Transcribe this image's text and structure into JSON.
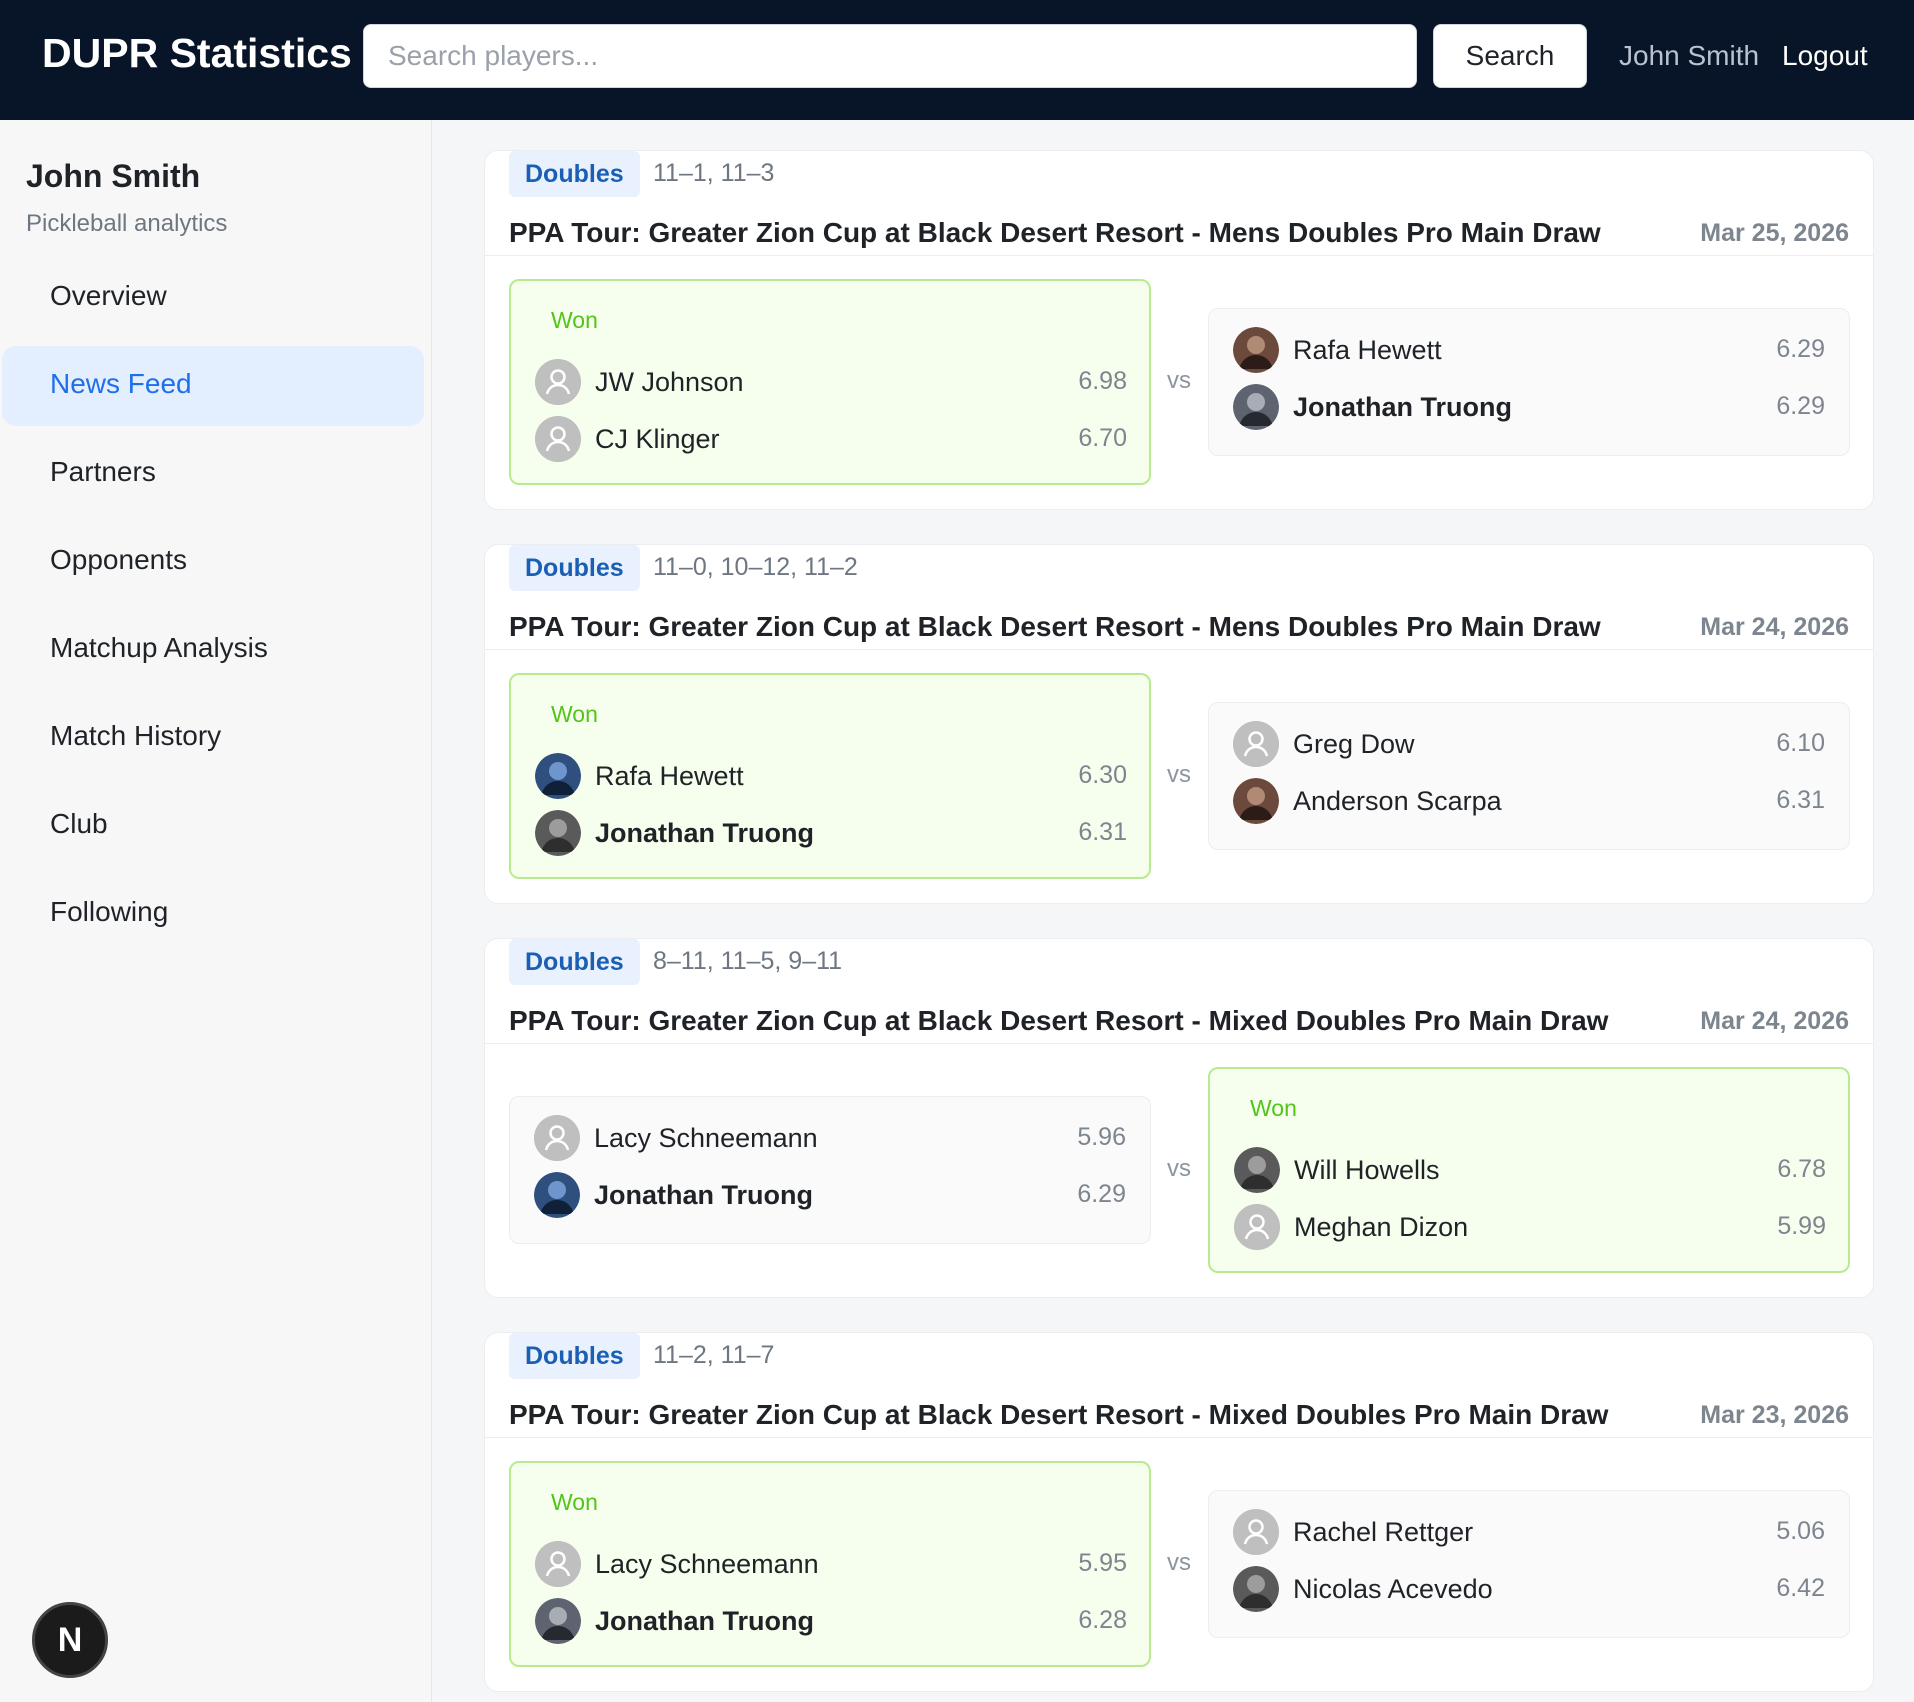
{
  "header": {
    "brand": "DUPR Statistics",
    "search_placeholder": "Search players...",
    "search_button": "Search",
    "user_name": "John Smith",
    "logout": "Logout"
  },
  "sidebar": {
    "user_name": "John Smith",
    "subtitle": "Pickleball analytics",
    "items": [
      {
        "label": "Overview",
        "active": false
      },
      {
        "label": "News Feed",
        "active": true
      },
      {
        "label": "Partners",
        "active": false
      },
      {
        "label": "Opponents",
        "active": false
      },
      {
        "label": "Matchup Analysis",
        "active": false
      },
      {
        "label": "Match History",
        "active": false
      },
      {
        "label": "Club",
        "active": false
      },
      {
        "label": "Following",
        "active": false
      }
    ],
    "badge_letter": "N"
  },
  "vs_label": "vs",
  "won_label": "Won",
  "matches": [
    {
      "type": "Doubles",
      "scores": "11–1, 11–3",
      "title": "PPA Tour: Greater Zion Cup at Black Desert Resort - Mens Doubles Pro Main Draw",
      "date": "Mar 25, 2026",
      "winner": "left",
      "left": [
        {
          "name": "JW Johnson",
          "rating": "6.98",
          "bold": false,
          "avatar": "default"
        },
        {
          "name": "CJ Klinger",
          "rating": "6.70",
          "bold": false,
          "avatar": "default"
        }
      ],
      "right": [
        {
          "name": "Rafa Hewett",
          "rating": "6.29",
          "bold": false,
          "avatar": "photo"
        },
        {
          "name": "Jonathan Truong",
          "rating": "6.29",
          "bold": true,
          "avatar": "photo"
        }
      ]
    },
    {
      "type": "Doubles",
      "scores": "11–0, 10–12, 11–2",
      "title": "PPA Tour: Greater Zion Cup at Black Desert Resort - Mens Doubles Pro Main Draw",
      "date": "Mar 24, 2026",
      "winner": "left",
      "left": [
        {
          "name": "Rafa Hewett",
          "rating": "6.30",
          "bold": false,
          "avatar": "photo"
        },
        {
          "name": "Jonathan Truong",
          "rating": "6.31",
          "bold": true,
          "avatar": "photo"
        }
      ],
      "right": [
        {
          "name": "Greg Dow",
          "rating": "6.10",
          "bold": false,
          "avatar": "default"
        },
        {
          "name": "Anderson Scarpa",
          "rating": "6.31",
          "bold": false,
          "avatar": "photo"
        }
      ]
    },
    {
      "type": "Doubles",
      "scores": "8–11, 11–5, 9–11",
      "title": "PPA Tour: Greater Zion Cup at Black Desert Resort - Mixed Doubles Pro Main Draw",
      "date": "Mar 24, 2026",
      "winner": "right",
      "left": [
        {
          "name": "Lacy Schneemann",
          "rating": "5.96",
          "bold": false,
          "avatar": "default"
        },
        {
          "name": "Jonathan Truong",
          "rating": "6.29",
          "bold": true,
          "avatar": "photo"
        }
      ],
      "right": [
        {
          "name": "Will Howells",
          "rating": "6.78",
          "bold": false,
          "avatar": "photo"
        },
        {
          "name": "Meghan Dizon",
          "rating": "5.99",
          "bold": false,
          "avatar": "default"
        }
      ]
    },
    {
      "type": "Doubles",
      "scores": "11–2, 11–7",
      "title": "PPA Tour: Greater Zion Cup at Black Desert Resort - Mixed Doubles Pro Main Draw",
      "date": "Mar 23, 2026",
      "winner": "left",
      "left": [
        {
          "name": "Lacy Schneemann",
          "rating": "5.95",
          "bold": false,
          "avatar": "default"
        },
        {
          "name": "Jonathan Truong",
          "rating": "6.28",
          "bold": true,
          "avatar": "photo"
        }
      ],
      "right": [
        {
          "name": "Rachel Rettger",
          "rating": "5.06",
          "bold": false,
          "avatar": "default"
        },
        {
          "name": "Nicolas Acevedo",
          "rating": "6.42",
          "bold": false,
          "avatar": "photo"
        }
      ]
    }
  ]
}
